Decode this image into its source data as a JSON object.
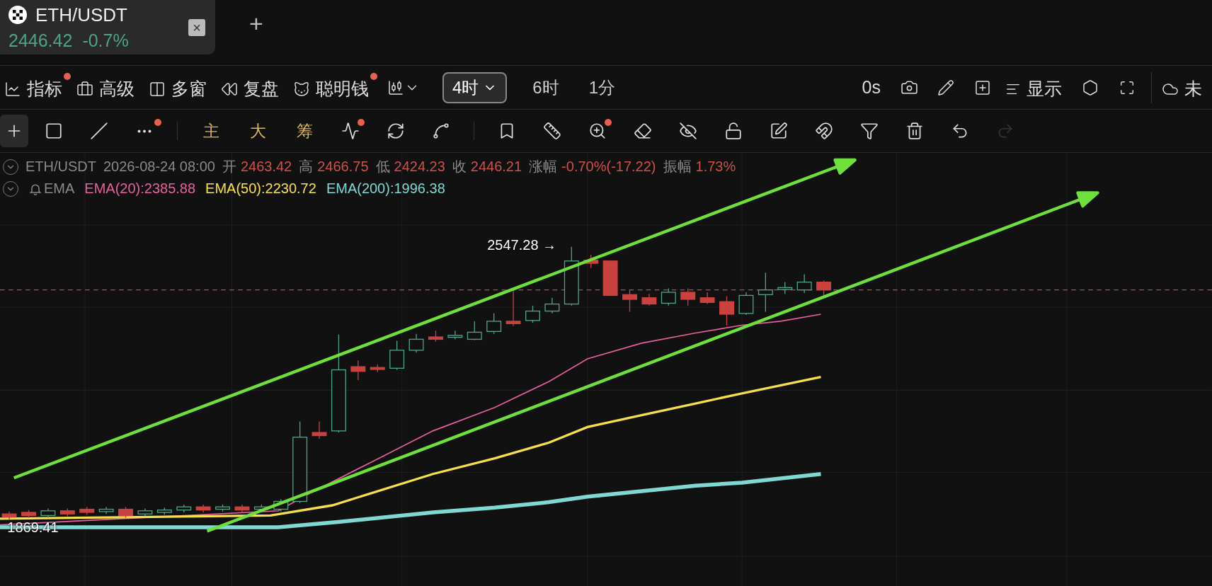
{
  "tab": {
    "symbol": "ETH/USDT",
    "price": "2446.42",
    "change": "-0.7%",
    "close": "×"
  },
  "add_tab": "+",
  "toolbar": {
    "items": [
      {
        "label": "指标",
        "dot": true
      },
      {
        "label": "高级",
        "dot": false
      },
      {
        "label": "多窗",
        "dot": false
      },
      {
        "label": "复盘",
        "dot": false
      },
      {
        "label": "聪明钱",
        "dot": true
      }
    ],
    "intervals": [
      {
        "label": "4时",
        "selected": true
      },
      {
        "label": "6时",
        "selected": false
      },
      {
        "label": "1分",
        "selected": false
      }
    ],
    "countdown": "0s",
    "display": "显示",
    "cloud": "未"
  },
  "draw_tools": [
    {
      "kind": "icon",
      "selected": true,
      "dot": false
    },
    {
      "kind": "icon",
      "selected": false,
      "dot": false
    },
    {
      "kind": "icon",
      "selected": false,
      "dot": false
    },
    {
      "kind": "icon",
      "selected": false,
      "dot": true
    },
    {
      "kind": "divider"
    },
    {
      "kind": "text",
      "label": "主"
    },
    {
      "kind": "text",
      "label": "大"
    },
    {
      "kind": "text",
      "label": "筹"
    },
    {
      "kind": "icon",
      "selected": false,
      "dot": true
    },
    {
      "kind": "icon",
      "selected": false,
      "dot": false
    },
    {
      "kind": "icon",
      "selected": false,
      "dot": false
    },
    {
      "kind": "divider"
    },
    {
      "kind": "icon",
      "selected": false,
      "dot": false
    },
    {
      "kind": "icon",
      "selected": false,
      "dot": false
    },
    {
      "kind": "icon",
      "selected": false,
      "dot": true
    },
    {
      "kind": "icon",
      "selected": false,
      "dot": false
    },
    {
      "kind": "icon",
      "selected": false,
      "dot": false
    },
    {
      "kind": "icon",
      "selected": false,
      "dot": false
    },
    {
      "kind": "icon",
      "selected": false,
      "dot": false
    },
    {
      "kind": "icon",
      "selected": false,
      "dot": false
    },
    {
      "kind": "icon",
      "selected": false,
      "dot": false
    },
    {
      "kind": "icon",
      "selected": false,
      "dot": false
    },
    {
      "kind": "icon",
      "selected": false,
      "dot": false,
      "disabled": false
    },
    {
      "kind": "icon",
      "selected": false,
      "dot": false,
      "disabled": true
    }
  ],
  "legend": {
    "symbol": "ETH/USDT",
    "time": "2026-08-24 08:00",
    "fields": [
      {
        "label": "开",
        "value": "2463.42"
      },
      {
        "label": "高",
        "value": "2466.75"
      },
      {
        "label": "低",
        "value": "2424.23"
      },
      {
        "label": "收",
        "value": "2446.21"
      },
      {
        "label": "涨幅",
        "value": "-0.70%(-17.22)"
      },
      {
        "label": "振幅",
        "value": "1.73%"
      }
    ],
    "indicator": "EMA",
    "emas": [
      {
        "label": "EMA(20):2385.88",
        "color": "#e8609f"
      },
      {
        "label": "EMA(50):2230.72",
        "color": "#f5e04a"
      },
      {
        "label": "EMA(200):1996.38",
        "color": "#7fd8d2"
      }
    ]
  },
  "chart": {
    "high_label": "2547.28 →",
    "low_label": "1869.41"
  }
}
